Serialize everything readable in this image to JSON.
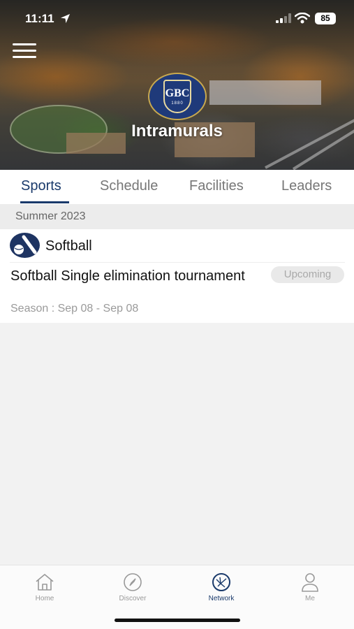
{
  "status_bar": {
    "time": "11:11",
    "battery": "85"
  },
  "header": {
    "logo_abbr": "GBC",
    "logo_year": "1880",
    "title": "Intramurals"
  },
  "tabs": [
    {
      "label": "Sports",
      "active": true
    },
    {
      "label": "Schedule",
      "active": false
    },
    {
      "label": "Facilities",
      "active": false
    },
    {
      "label": "Leaders",
      "active": false
    }
  ],
  "season": {
    "label": "Summer 2023"
  },
  "sport": {
    "name": "Softball",
    "icon": "softball-icon",
    "league": {
      "title": "Softball Single elimination tournament",
      "status": "Upcoming",
      "dates": "Season : Sep 08 - Sep 08"
    }
  },
  "bottom_nav": [
    {
      "label": "Home",
      "icon": "home-icon"
    },
    {
      "label": "Discover",
      "icon": "compass-icon"
    },
    {
      "label": "Network",
      "icon": "network-icon",
      "active": true
    },
    {
      "label": "Me",
      "icon": "person-icon"
    }
  ],
  "colors": {
    "accent": "#1a3a6b",
    "badge_bg": "#e9e9e9",
    "badge_text": "#a9a9a9"
  }
}
